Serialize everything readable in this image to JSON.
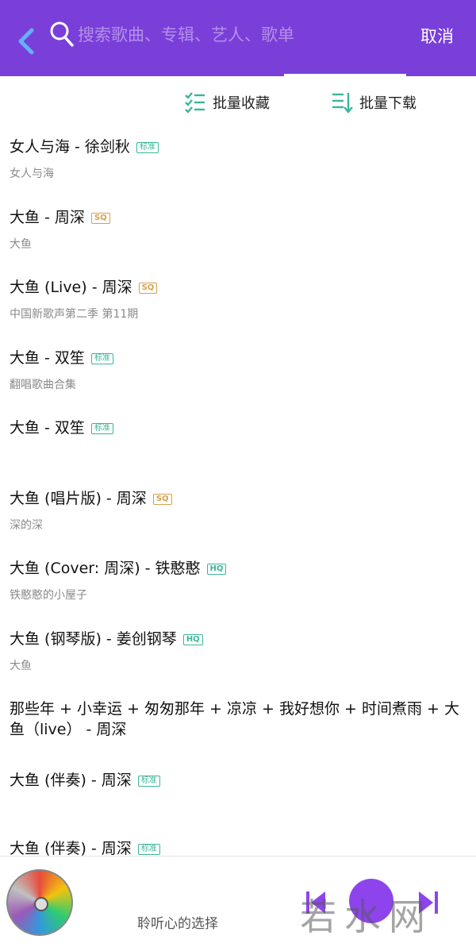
{
  "search": {
    "placeholder": "搜索歌曲、专辑、艺人、歌单",
    "cancel_label": "取消"
  },
  "actions": {
    "batch_favorite": "批量收藏",
    "batch_download": "批量下载"
  },
  "songs": [
    {
      "title": "女人与海 - 徐剑秋",
      "badge": "标准",
      "subtitle": "女人与海"
    },
    {
      "title": "大鱼 - 周深",
      "badge": "SQ",
      "subtitle": "大鱼"
    },
    {
      "title": "大鱼 (Live) - 周深",
      "badge": "SQ",
      "subtitle": "中国新歌声第二季 第11期"
    },
    {
      "title": "大鱼 - 双笙",
      "badge": "标准",
      "subtitle": "翻唱歌曲合集"
    },
    {
      "title": "大鱼 - 双笙",
      "badge": "标准",
      "subtitle": ""
    },
    {
      "title": "大鱼 (唱片版) - 周深",
      "badge": "SQ",
      "subtitle": "深的深"
    },
    {
      "title": "大鱼 (Cover: 周深) - 铁憨憨",
      "badge": "HQ",
      "subtitle": "铁憨憨的小屋子"
    },
    {
      "title": "大鱼 (钢琴版) - 姜创钢琴",
      "badge": "HQ",
      "subtitle": "大鱼"
    },
    {
      "title": "那些年 + 小幸运 + 匆匆那年 + 凉凉 + 我好想你 + 时间煮雨 + 大鱼（live） - 周深",
      "badge": "",
      "subtitle": ""
    },
    {
      "title": "大鱼 (伴奏) - 周深",
      "badge": "标准",
      "subtitle": ""
    },
    {
      "title": "大鱼 (伴奏) - 周深",
      "badge": "标准",
      "subtitle": ""
    }
  ],
  "player": {
    "now_playing_text": "聆听心的选择",
    "watermark": "若水网"
  },
  "colors": {
    "header": "#7a3fd9",
    "accent_green": "#3ab59a",
    "sq_gold": "#d8a04b",
    "play_button": "#8e44ec"
  }
}
